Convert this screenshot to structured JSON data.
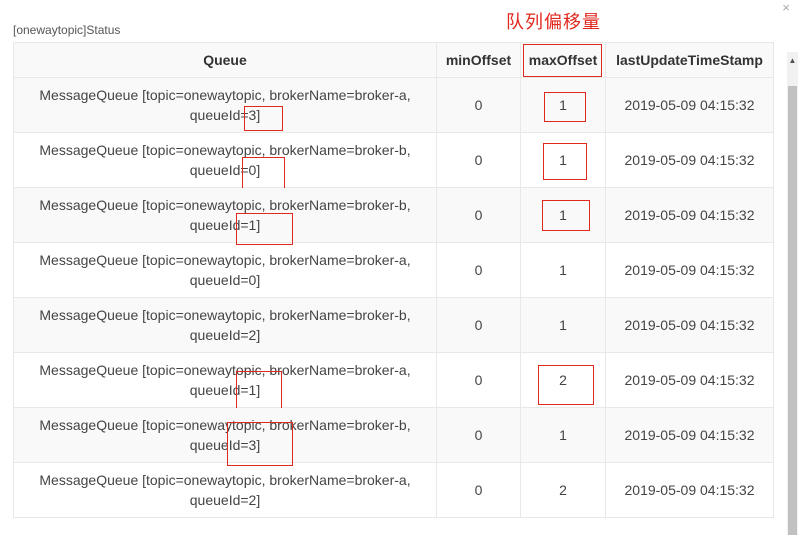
{
  "dialog": {
    "title": "[onewaytopic]Status",
    "annotation": "队列偏移量",
    "close_glyph": "×"
  },
  "table": {
    "headers": {
      "queue": "Queue",
      "min_offset": "minOffset",
      "max_offset": "maxOffset",
      "last_update": "lastUpdateTimeStamp"
    },
    "rows": [
      {
        "queue_line1": "MessageQueue [topic=onewaytopic, brokerName=broker-a,",
        "queue_line2": "queueId=3]",
        "min": "0",
        "max": "1",
        "ts": "2019-05-09 04:15:32"
      },
      {
        "queue_line1": "MessageQueue [topic=onewaytopic, brokerName=broker-b,",
        "queue_line2": "queueId=0]",
        "min": "0",
        "max": "1",
        "ts": "2019-05-09 04:15:32"
      },
      {
        "queue_line1": "MessageQueue [topic=onewaytopic, brokerName=broker-b,",
        "queue_line2": "queueId=1]",
        "min": "0",
        "max": "1",
        "ts": "2019-05-09 04:15:32"
      },
      {
        "queue_line1": "MessageQueue [topic=onewaytopic, brokerName=broker-a,",
        "queue_line2": "queueId=0]",
        "min": "0",
        "max": "1",
        "ts": "2019-05-09 04:15:32"
      },
      {
        "queue_line1": "MessageQueue [topic=onewaytopic, brokerName=broker-b,",
        "queue_line2": "queueId=2]",
        "min": "0",
        "max": "1",
        "ts": "2019-05-09 04:15:32"
      },
      {
        "queue_line1": "MessageQueue [topic=onewaytopic, brokerName=broker-a,",
        "queue_line2": "queueId=1]",
        "min": "0",
        "max": "2",
        "ts": "2019-05-09 04:15:32"
      },
      {
        "queue_line1": "MessageQueue [topic=onewaytopic, brokerName=broker-b,",
        "queue_line2": "queueId=3]",
        "min": "0",
        "max": "1",
        "ts": "2019-05-09 04:15:32"
      },
      {
        "queue_line1": "MessageQueue [topic=onewaytopic, brokerName=broker-a,",
        "queue_line2": "queueId=2]",
        "min": "0",
        "max": "2",
        "ts": "2019-05-09 04:15:32"
      }
    ]
  },
  "scrollbar": {
    "up_glyph": "▲"
  },
  "colors": {
    "annotation_red": "#e0281e",
    "header_bg": "#f9f9f9",
    "border": "#e8e8e8"
  }
}
